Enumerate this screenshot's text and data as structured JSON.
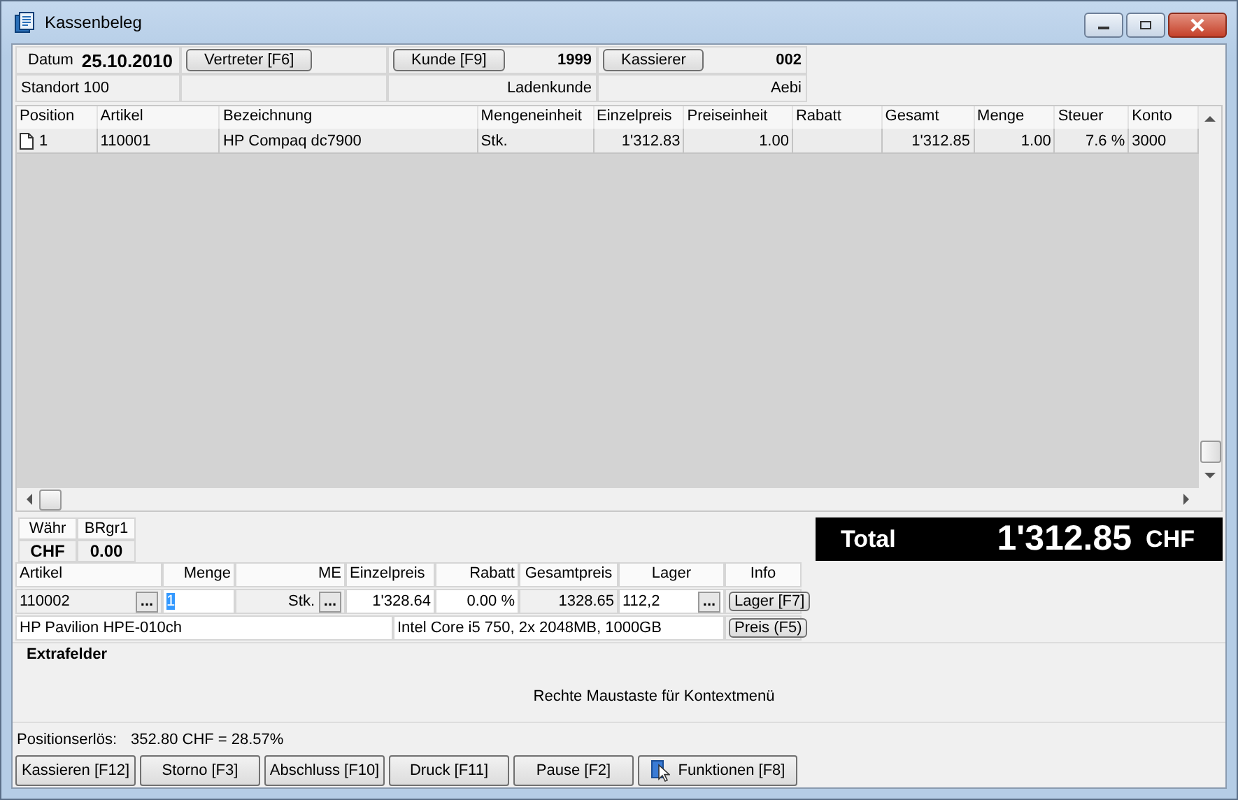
{
  "window": {
    "title": "Kassenbeleg"
  },
  "header": {
    "date_label": "Datum",
    "date": "25.10.2010",
    "vertreter_button": "Vertreter [F6]",
    "kunde_button": "Kunde [F9]",
    "kunde_nr": "1999",
    "kassierer_button": "Kassierer",
    "kassierer_nr": "002",
    "standort": "Standort 100",
    "kunde_name": "Ladenkunde",
    "kassierer_name": "Aebi"
  },
  "table": {
    "columns": [
      "Position",
      "Artikel",
      "Bezeichnung",
      "Mengeneinheit",
      "Einzelpreis",
      "Preiseinheit",
      "Rabatt",
      "Gesamt",
      "Menge",
      "Steuer",
      "Konto"
    ],
    "rows": [
      {
        "selected": true,
        "cells": [
          "1",
          "110001",
          "HP Compaq dc7900",
          "Stk.",
          "1'312.83",
          "1.00",
          "",
          "1'312.85",
          "1.00",
          "7.6 %",
          "3000"
        ]
      }
    ]
  },
  "currency": {
    "headers": [
      "Währ",
      "BRgr1"
    ],
    "values": [
      "CHF",
      "0.00"
    ]
  },
  "total": {
    "label": "Total",
    "amount": "1'312.85",
    "currency": "CHF"
  },
  "entry": {
    "columns": [
      "Artikel",
      "Menge",
      "ME",
      "Einzelpreis",
      "Rabatt",
      "Gesamtpreis",
      "Lager",
      "Info"
    ],
    "artikel": "110002",
    "menge": "1",
    "menge_selected": true,
    "me": "Stk.",
    "einzelpreis": "1'328.64",
    "rabatt": "0.00 %",
    "gesamtpreis": "1328.65",
    "lager": "112,2",
    "lager_button": "Lager [F7]",
    "browse_button": "...",
    "bezeichnung": "HP Pavilion HPE-010ch",
    "beschreibung": "Intel Core i5 750, 2x 2048MB, 1000GB",
    "preis_button": "Preis (F5)"
  },
  "extrafelder": {
    "title": "Extrafelder",
    "hint": "Rechte Maustaste für Kontextmenü"
  },
  "status": {
    "label": "Positionserlös:",
    "value": "352.80 CHF = 28.57%"
  },
  "buttons": [
    {
      "label": "Kassieren [F12]",
      "kind": "plain"
    },
    {
      "label": "Storno [F3]",
      "kind": "plain"
    },
    {
      "label": "Abschluss [F10]",
      "kind": "plain"
    },
    {
      "label": "Druck [F11]",
      "kind": "plain"
    },
    {
      "label": "Pause [F2]",
      "kind": "plain"
    },
    {
      "label": "Funktionen [F8]",
      "kind": "icon"
    }
  ]
}
